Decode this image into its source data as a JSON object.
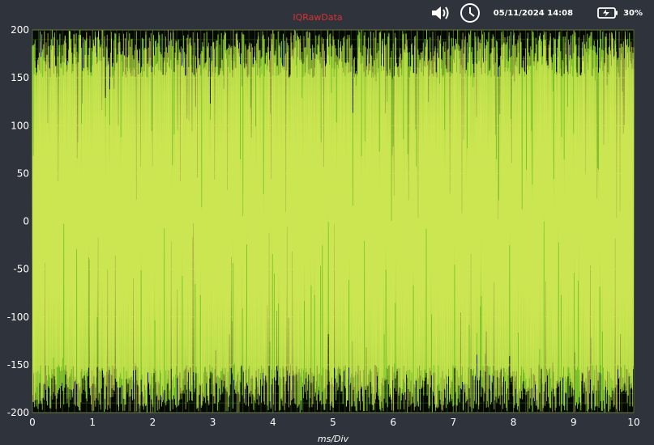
{
  "status_bar": {
    "datetime": "05/11/2024  14:08",
    "battery": "30%",
    "icons": [
      "speaker-icon",
      "clock-icon",
      "battery-charging-icon"
    ]
  },
  "colors": {
    "background": "#2f333b",
    "plot_background": "#060806",
    "trace_i": "#7fcf2a",
    "trace_q": "#e8f060",
    "title": "#d83232",
    "text": "#ffffff"
  },
  "chart_data": {
    "type": "line",
    "title": "IQRawData",
    "xlabel": "ms/Div",
    "ylabel": "",
    "xlim": [
      0,
      10
    ],
    "ylim": [
      -200,
      200
    ],
    "x_ticks": [
      0,
      1,
      2,
      3,
      4,
      5,
      6,
      7,
      8,
      9,
      10
    ],
    "y_ticks": [
      200,
      150,
      100,
      50,
      0,
      -50,
      -100,
      -150,
      -200
    ],
    "grid": true,
    "legend": "none",
    "series": [
      {
        "color": "#7fcf2a",
        "amplitude_range": [
          -200,
          200
        ],
        "description_style": "dense oscillation"
      },
      {
        "color": "#e8f060",
        "amplitude_range": [
          -200,
          200
        ],
        "description_style": "dense oscillation"
      }
    ]
  }
}
